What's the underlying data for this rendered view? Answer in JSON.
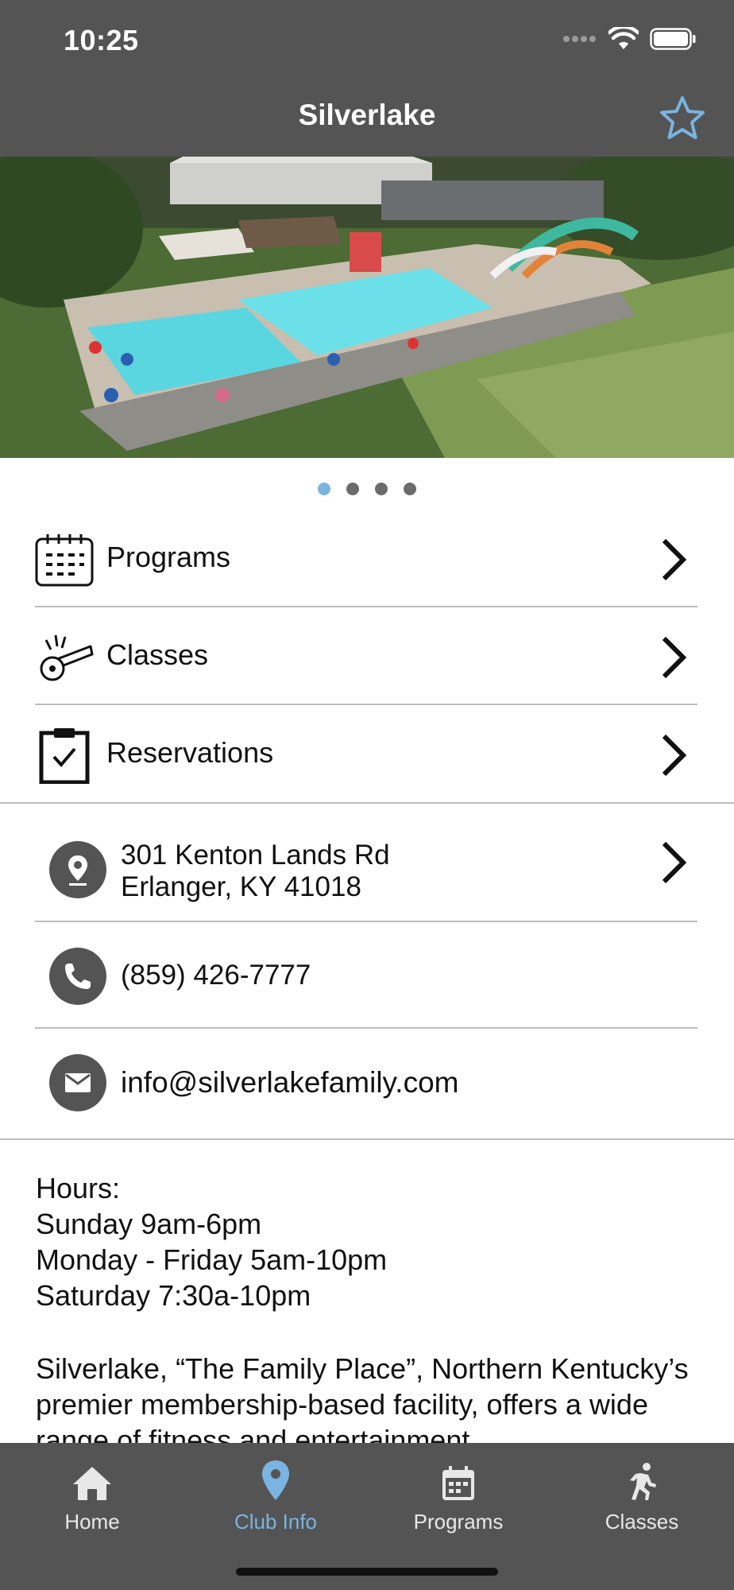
{
  "status": {
    "time": "10:25"
  },
  "header": {
    "title": "Silverlake"
  },
  "gallery": {
    "active_index": 0,
    "page_count": 4
  },
  "menu": [
    {
      "label": "Programs",
      "icon": "calendar-icon"
    },
    {
      "label": "Classes",
      "icon": "whistle-icon"
    },
    {
      "label": "Reservations",
      "icon": "clipboard-check-icon"
    }
  ],
  "contact": {
    "address_line1": "301 Kenton Lands Rd",
    "address_line2": "Erlanger, KY 41018",
    "phone": "(859) 426-7777",
    "email": "info@silverlakefamily.com"
  },
  "hours": {
    "heading": "Hours:",
    "lines": [
      "Sunday 9am-6pm",
      "Monday - Friday 5am-10pm",
      "Saturday 7:30a-10pm"
    ]
  },
  "description": "Silverlake, “The Family Place”, Northern Kentucky’s premier membership-based facility, offers a wide range of fitness and entertainment",
  "tabs": [
    {
      "label": "Home",
      "icon": "home-icon"
    },
    {
      "label": "Club Info",
      "icon": "location-pin-icon"
    },
    {
      "label": "Programs",
      "icon": "calendar-icon"
    },
    {
      "label": "Classes",
      "icon": "runner-icon"
    }
  ],
  "active_tab": "Club Info",
  "colors": {
    "bar": "#545454",
    "accent": "#7ab4e0",
    "separator": "#bdbdbd"
  }
}
